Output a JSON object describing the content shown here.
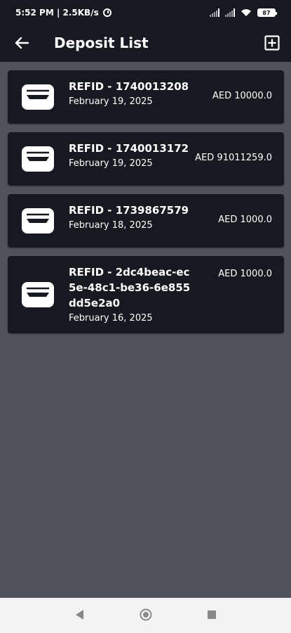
{
  "status_bar": {
    "time_info": "5:52 PM | 2.5KB/s",
    "battery": "87"
  },
  "header": {
    "title": "Deposit List"
  },
  "deposits": [
    {
      "refid": "REFID - 1740013208",
      "date": "February 19, 2025",
      "amount": "AED 10000.0"
    },
    {
      "refid": "REFID - 1740013172",
      "date": "February 19, 2025",
      "amount": "AED 91011259.0"
    },
    {
      "refid": "REFID - 1739867579",
      "date": "February 18, 2025",
      "amount": "AED 1000.0"
    },
    {
      "refid": "REFID - 2dc4beac-ec5e-48c1-be36-6e855dd5e2a0",
      "date": "February 16, 2025",
      "amount": "AED 1000.0"
    }
  ],
  "colors": {
    "background": "#4f535c",
    "surface": "#161a20",
    "text": "#ffffff",
    "nav_bar": "#f3f3f3"
  },
  "icons": {
    "back": "arrow-left-icon",
    "add": "add-box-icon",
    "card": "wallet-icon"
  }
}
